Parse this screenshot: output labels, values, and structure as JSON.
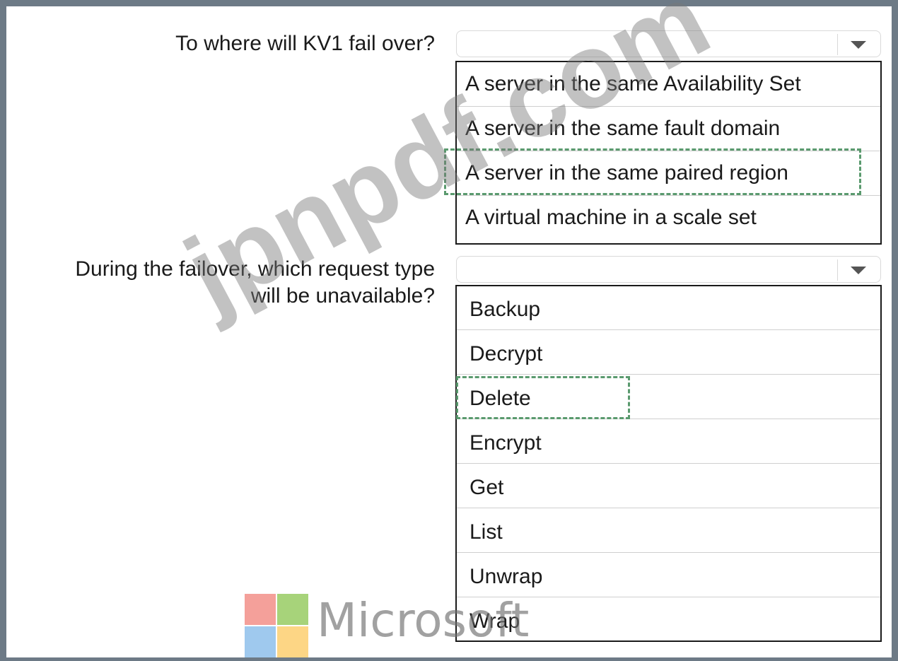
{
  "questions": [
    {
      "prompt": "To where will KV1 fail over?",
      "selected": "",
      "options": [
        "A server in the same Availability Set",
        "A server in the same fault domain",
        "A server in the same paired region",
        "A virtual machine in a scale set"
      ],
      "highlighted_option": "A server in the same paired region"
    },
    {
      "prompt": "During the failover, which request type will be unavailable?",
      "selected": "",
      "options": [
        "Backup",
        "Decrypt",
        "Delete",
        "Encrypt",
        "Get",
        "List",
        "Unwrap",
        "Wrap"
      ],
      "highlighted_option": "Delete"
    }
  ],
  "watermark": "jpnpdf.com",
  "brand": {
    "text": "Microsoft",
    "colors": [
      "#f4a09a",
      "#a7d37a",
      "#9fc9ee",
      "#fdd685"
    ]
  },
  "icons": {
    "dropdown": "chevron-down-icon"
  },
  "colors": {
    "frame": "#6d7a86",
    "answer_highlight": "#5a9a6e"
  }
}
